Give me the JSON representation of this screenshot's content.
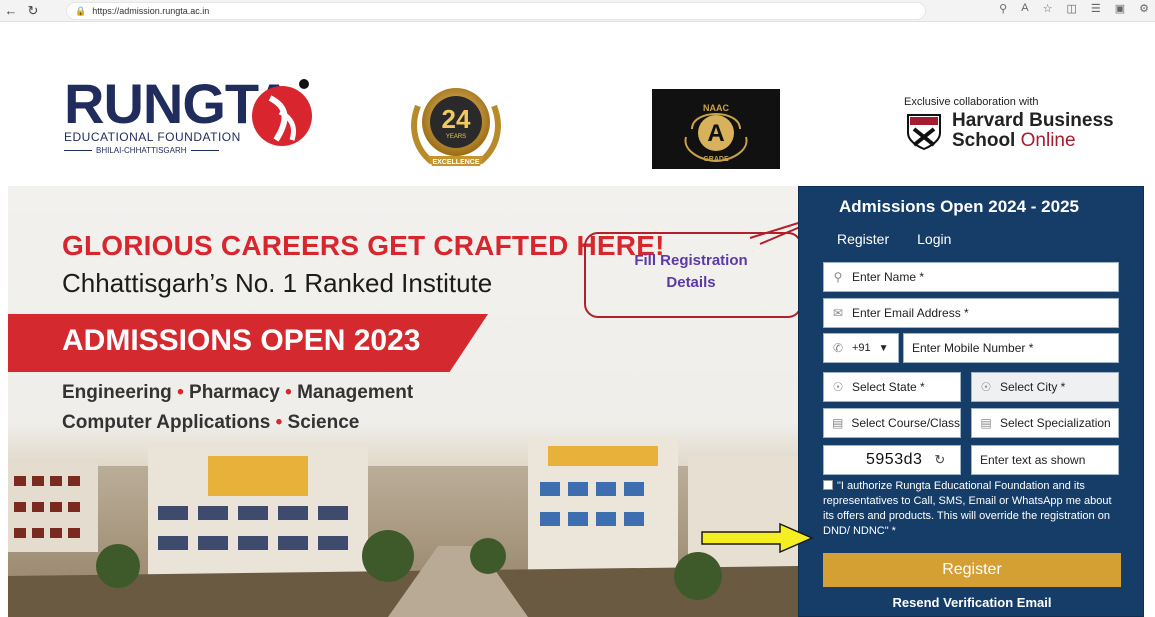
{
  "browser": {
    "url": "https://admission.rungta.ac.in",
    "back_icon": "back-arrow-icon",
    "refresh_icon": "refresh-icon"
  },
  "header": {
    "rungta_word": "RUNGTA",
    "rungta_sub": "EDUCATIONAL FOUNDATION",
    "rungta_place": "BHILAI-CHHATTISGARH",
    "badge_years": "24",
    "badge_years_label": "YEARS",
    "badge_excellence": "EXCELLENCE",
    "naac_label": "NAAC",
    "naac_grade": "A",
    "naac_grade_word": "GRADE",
    "harvard_collab": "Exclusive collaboration with",
    "harvard_line1": "Harvard Business",
    "harvard_line2_bold": "School",
    "harvard_line2_online": "Online"
  },
  "hero": {
    "headline": "GLORIOUS CAREERS GET CRAFTED HERE!",
    "subheadline": "Chhattisgarh’s No. 1 Ranked Institute",
    "admissions_banner": "ADMISSIONS OPEN 2023",
    "course_engineering": "Engineering",
    "course_pharmacy": "Pharmacy",
    "course_management": "Management",
    "course_computer": "Computer Applications",
    "course_science": "Science",
    "dot": "•"
  },
  "annotation": {
    "line1": "Fill Registration",
    "line2": "Details"
  },
  "form": {
    "title": "Admissions Open 2024 - 2025",
    "tab_register": "Register",
    "tab_login": "Login",
    "name_placeholder": "Enter Name *",
    "email_placeholder": "Enter Email Address *",
    "country_code": "+91",
    "mobile_placeholder": "Enter Mobile Number *",
    "state_placeholder": "Select State *",
    "city_placeholder": "Select City *",
    "course_placeholder": "Select Course/Class",
    "specialization_placeholder": "Select Specialization",
    "captcha_text": "5953d3",
    "captcha_input_placeholder": "Enter text as shown",
    "consent_text": "\"I authorize Rungta Educational Foundation and its representatives to Call, SMS, Email or WhatsApp me about its offers and products. This will override the registration on DND/ NDNC\" *",
    "register_button": "Register",
    "resend_link": "Resend Verification Email"
  },
  "colors": {
    "panel_bg": "#153d68",
    "accent_red": "#d42a2f",
    "register_gold": "#d4a034",
    "annotation_purple": "#5b3aa8"
  }
}
